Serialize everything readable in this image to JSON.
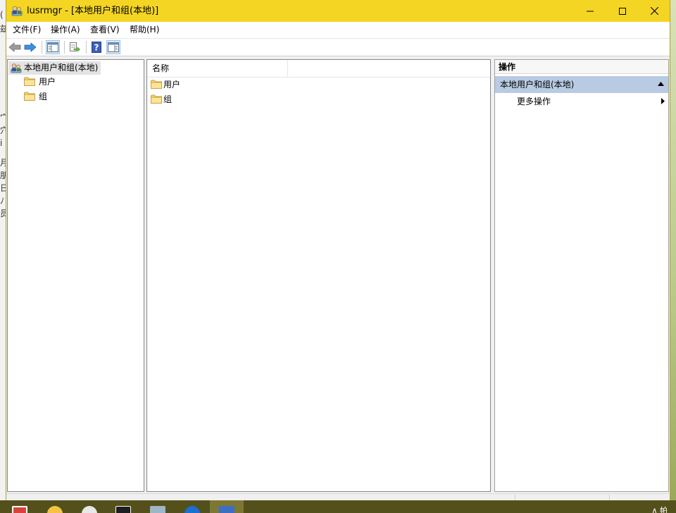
{
  "background": {
    "left_chars": [
      "(",
      "兹",
      "宀",
      "穴",
      "i",
      "月",
      "朋",
      "日",
      "ﾉ",
      "员"
    ]
  },
  "window": {
    "title": "lusrmgr - [本地用户和组(本地)]",
    "accent_color": "#f4d523",
    "controls": {
      "minimize": "minimize",
      "maximize": "maximize",
      "close": "close"
    }
  },
  "menu": {
    "items": [
      "文件(F)",
      "操作(A)",
      "查看(V)",
      "帮助(H)"
    ]
  },
  "toolbar": {
    "buttons": [
      "back-icon",
      "forward-icon",
      "show-hide-tree-icon",
      "export-list-icon",
      "help-icon",
      "show-hide-action-pane-icon"
    ]
  },
  "tree": {
    "root": "本地用户和组(本地)",
    "children": [
      "用户",
      "组"
    ]
  },
  "list": {
    "column_name": "名称",
    "items": [
      "用户",
      "组"
    ]
  },
  "actions": {
    "title": "操作",
    "section": "本地用户和组(本地)",
    "more": "更多操作"
  },
  "taskbar": {
    "tray_text": "∧ 帕"
  }
}
